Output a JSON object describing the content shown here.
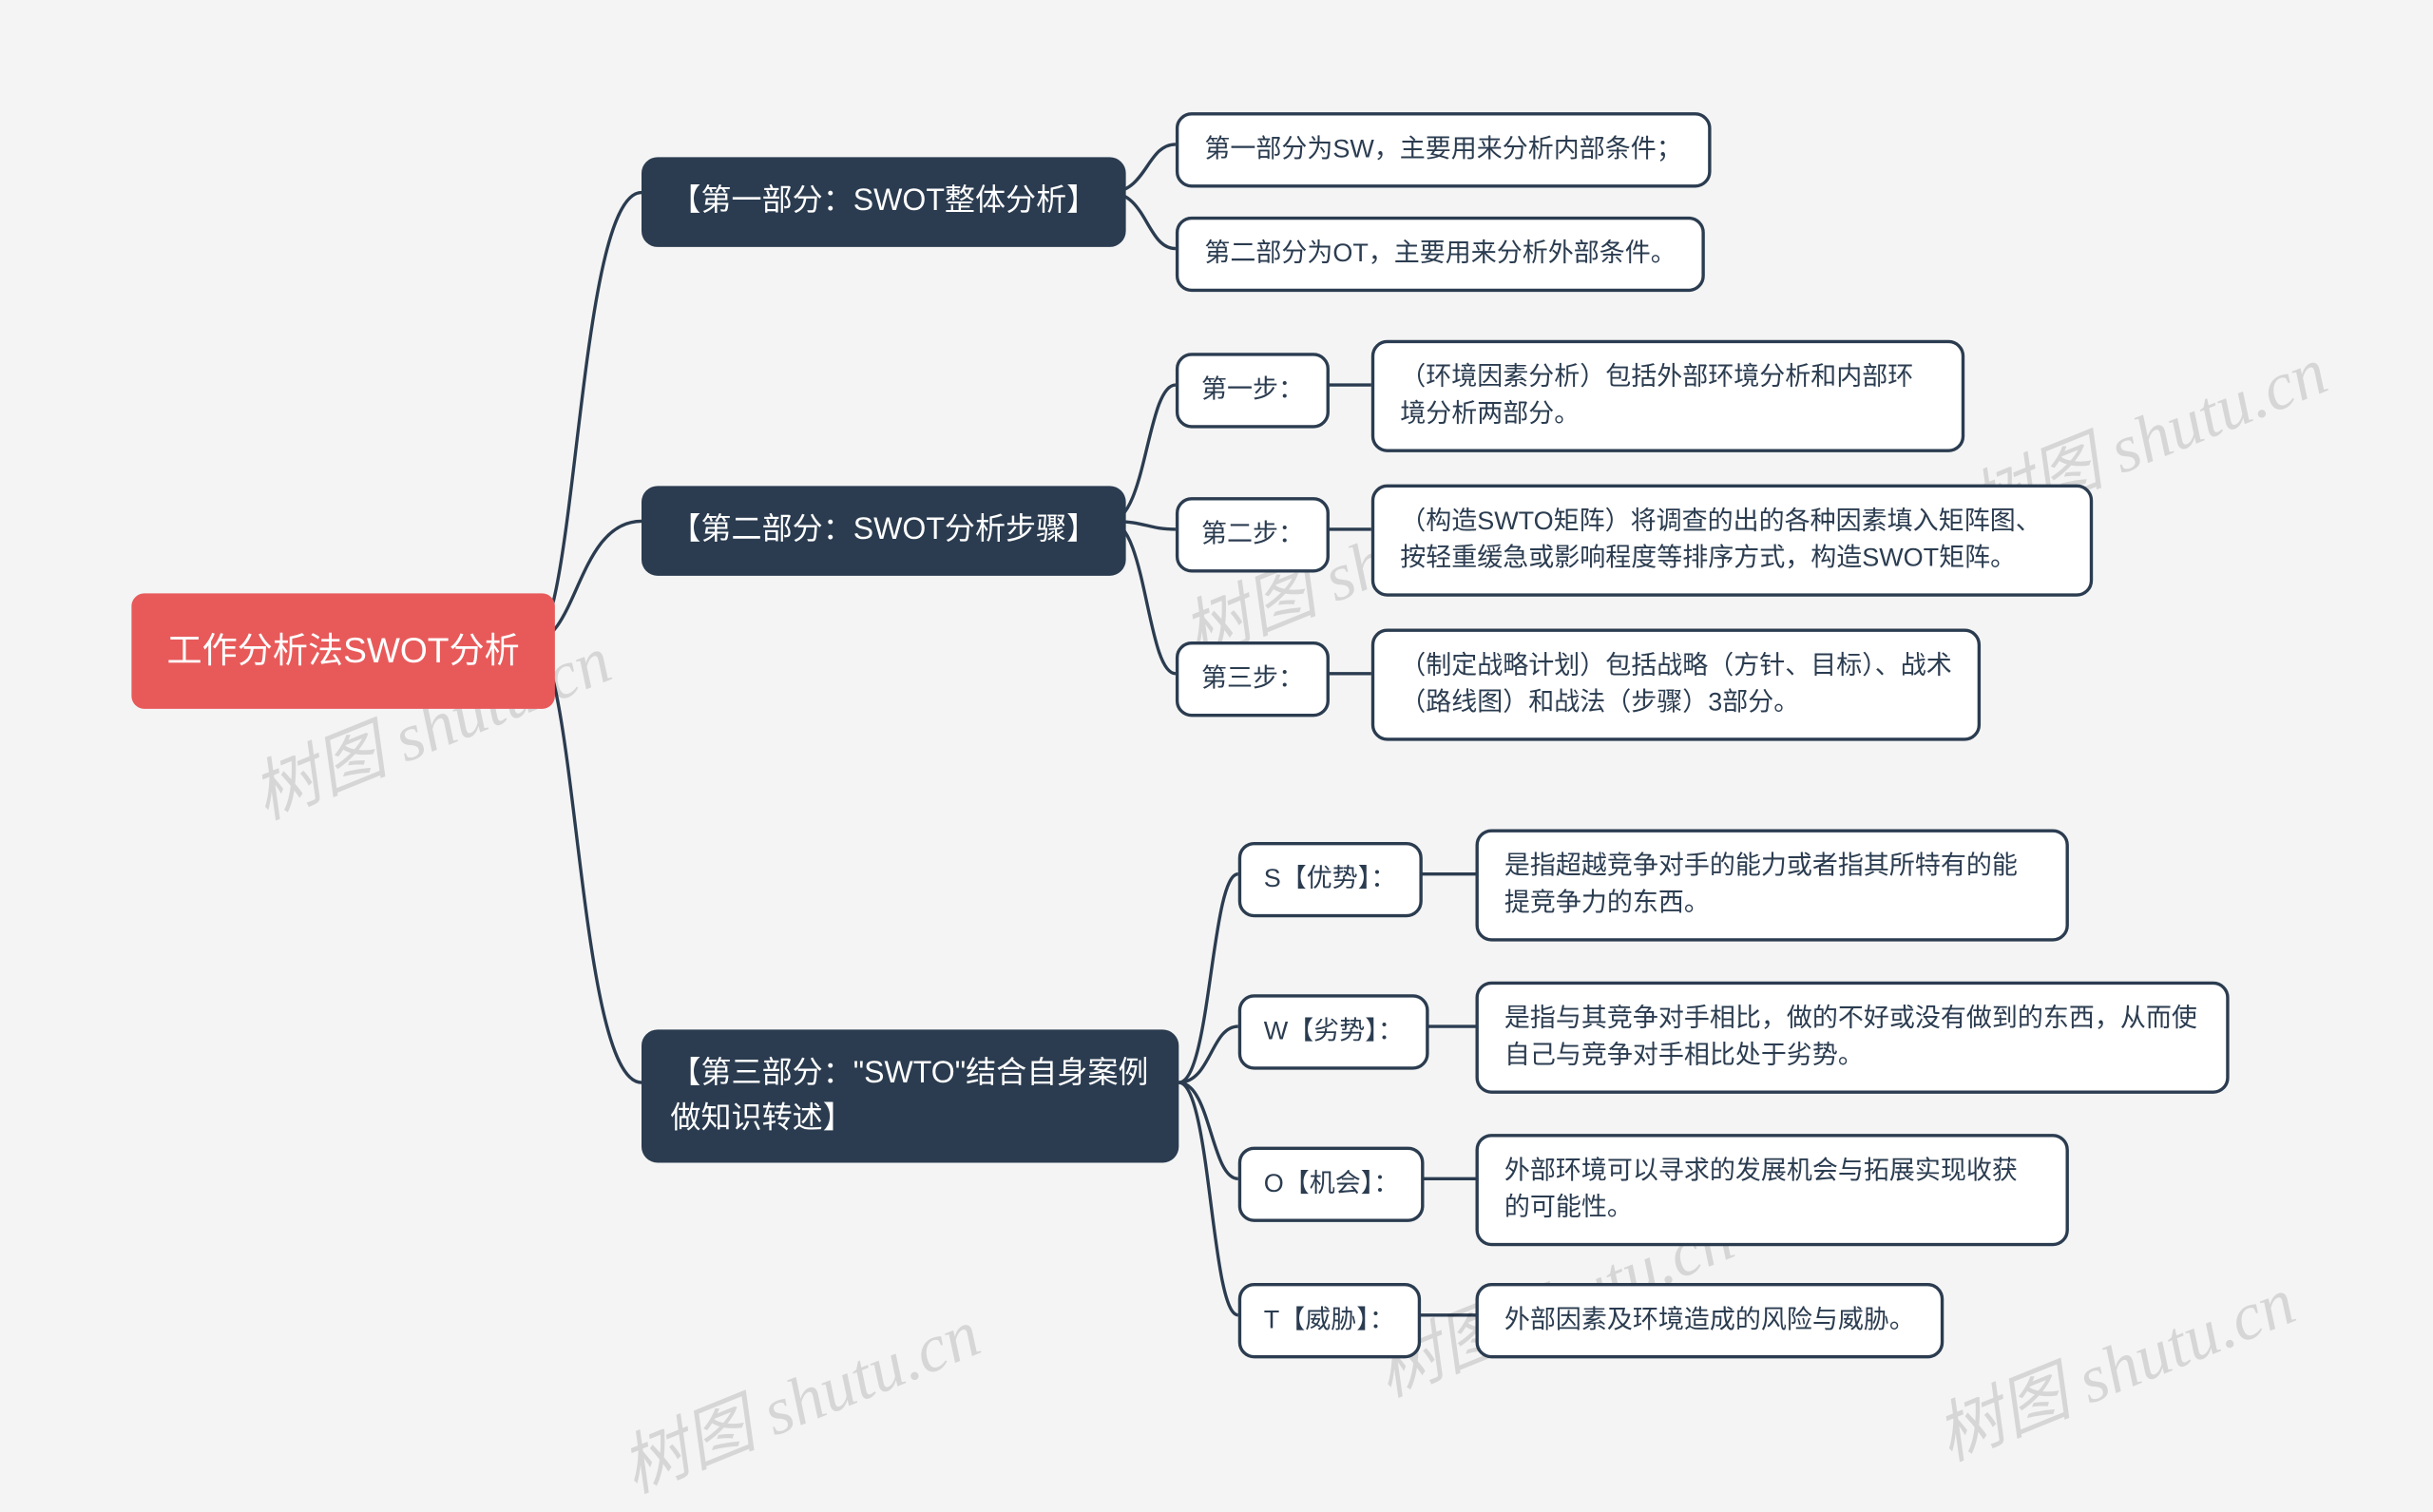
{
  "root": "工作分析法SWOT分析",
  "branches": {
    "b1": {
      "label": "【第一部分：SWOT整体分析】",
      "leaves": {
        "l1": "第一部分为SW，主要用来分析内部条件；",
        "l2": "第二部分为OT，主要用来分析外部条件。"
      }
    },
    "b2": {
      "label": "【第二部分：SWOT分析步骤】",
      "mids": {
        "m1": {
          "label": "第一步：",
          "leaf": "（环境因素分析）包括外部环境分析和内部环境分析两部分。"
        },
        "m2": {
          "label": "第二步：",
          "leaf": "（构造SWTO矩阵）将调查的出的各种因素填入矩阵图、按轻重缓急或影响程度等排序方式，构造SWOT矩阵。"
        },
        "m3": {
          "label": "第三步：",
          "leaf": "（制定战略计划）包括战略（方针、目标）、战术（路线图）和战法（步骤）3部分。"
        }
      }
    },
    "b3": {
      "label": "【第三部分：\"SWTO\"结合自身案例做知识转述】",
      "mids": {
        "m1": {
          "label": "S【优势】：",
          "leaf": "是指超越竞争对手的能力或者指其所特有的能提竞争力的东西。"
        },
        "m2": {
          "label": "W【劣势】：",
          "leaf": "是指与其竞争对手相比，做的不好或没有做到的东西，从而使自己与竞争对手相比处于劣势。"
        },
        "m3": {
          "label": "O【机会】：",
          "leaf": "外部环境可以寻求的发展机会与拓展实现收获的可能性。"
        },
        "m4": {
          "label": "T【威胁】：",
          "leaf": "外部因素及环境造成的风险与威胁。"
        }
      }
    }
  },
  "watermark": "树图 shutu.cn",
  "colors": {
    "root_bg": "#e85a5a",
    "branch_bg": "#2b3c50",
    "leaf_border": "#2b3c50",
    "canvas_bg": "#f4f4f4"
  },
  "chart_data": {
    "type": "mindmap",
    "root": "工作分析法SWOT分析",
    "children": [
      {
        "label": "【第一部分：SWOT整体分析】",
        "children": [
          {
            "label": "第一部分为SW，主要用来分析内部条件；"
          },
          {
            "label": "第二部分为OT，主要用来分析外部条件。"
          }
        ]
      },
      {
        "label": "【第二部分：SWOT分析步骤】",
        "children": [
          {
            "label": "第一步：",
            "children": [
              {
                "label": "（环境因素分析）包括外部环境分析和内部环境分析两部分。"
              }
            ]
          },
          {
            "label": "第二步：",
            "children": [
              {
                "label": "（构造SWTO矩阵）将调查的出的各种因素填入矩阵图、按轻重缓急或影响程度等排序方式，构造SWOT矩阵。"
              }
            ]
          },
          {
            "label": "第三步：",
            "children": [
              {
                "label": "（制定战略计划）包括战略（方针、目标）、战术（路线图）和战法（步骤）3部分。"
              }
            ]
          }
        ]
      },
      {
        "label": "【第三部分：\"SWTO\"结合自身案例做知识转述】",
        "children": [
          {
            "label": "S【优势】：",
            "children": [
              {
                "label": "是指超越竞争对手的能力或者指其所特有的能提竞争力的东西。"
              }
            ]
          },
          {
            "label": "W【劣势】：",
            "children": [
              {
                "label": "是指与其竞争对手相比，做的不好或没有做到的东西，从而使自己与竞争对手相比处于劣势。"
              }
            ]
          },
          {
            "label": "O【机会】：",
            "children": [
              {
                "label": "外部环境可以寻求的发展机会与拓展实现收获的可能性。"
              }
            ]
          },
          {
            "label": "T【威胁】：",
            "children": [
              {
                "label": "外部因素及环境造成的风险与威胁。"
              }
            ]
          }
        ]
      }
    ]
  }
}
